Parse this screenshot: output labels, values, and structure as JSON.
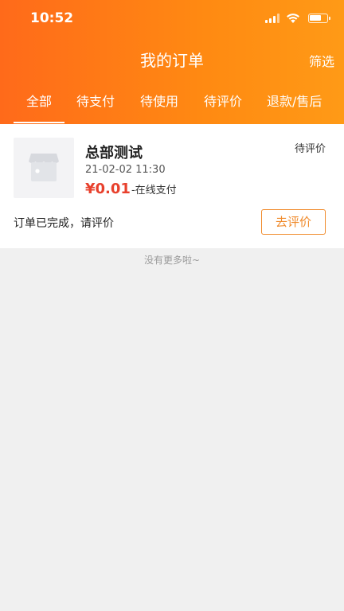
{
  "status_bar": {
    "time": "10:52",
    "icons": [
      "cellular-signal-icon",
      "wifi-icon",
      "battery-icon"
    ]
  },
  "header": {
    "title": "我的订单",
    "filter_label": "筛选"
  },
  "tabs": [
    {
      "label": "全部",
      "active": true
    },
    {
      "label": "待支付",
      "active": false
    },
    {
      "label": "待使用",
      "active": false
    },
    {
      "label": "待评价",
      "active": false
    },
    {
      "label": "退款/售后",
      "active": false
    }
  ],
  "orders": [
    {
      "thumbnail_icon": "store-icon",
      "store_name": "总部测试",
      "status": "待评价",
      "date": "21-02-02 11:30",
      "price": "¥0.01",
      "payment_method": "-在线支付",
      "hint": "订单已完成，请评价",
      "action_label": "去评价"
    }
  ],
  "footer": {
    "no_more_text": "没有更多啦~"
  },
  "colors": {
    "header_orange": "#ff7a16",
    "price_red": "#e8412d",
    "button_orange": "#f08b2c",
    "background": "#f0f0f0"
  }
}
